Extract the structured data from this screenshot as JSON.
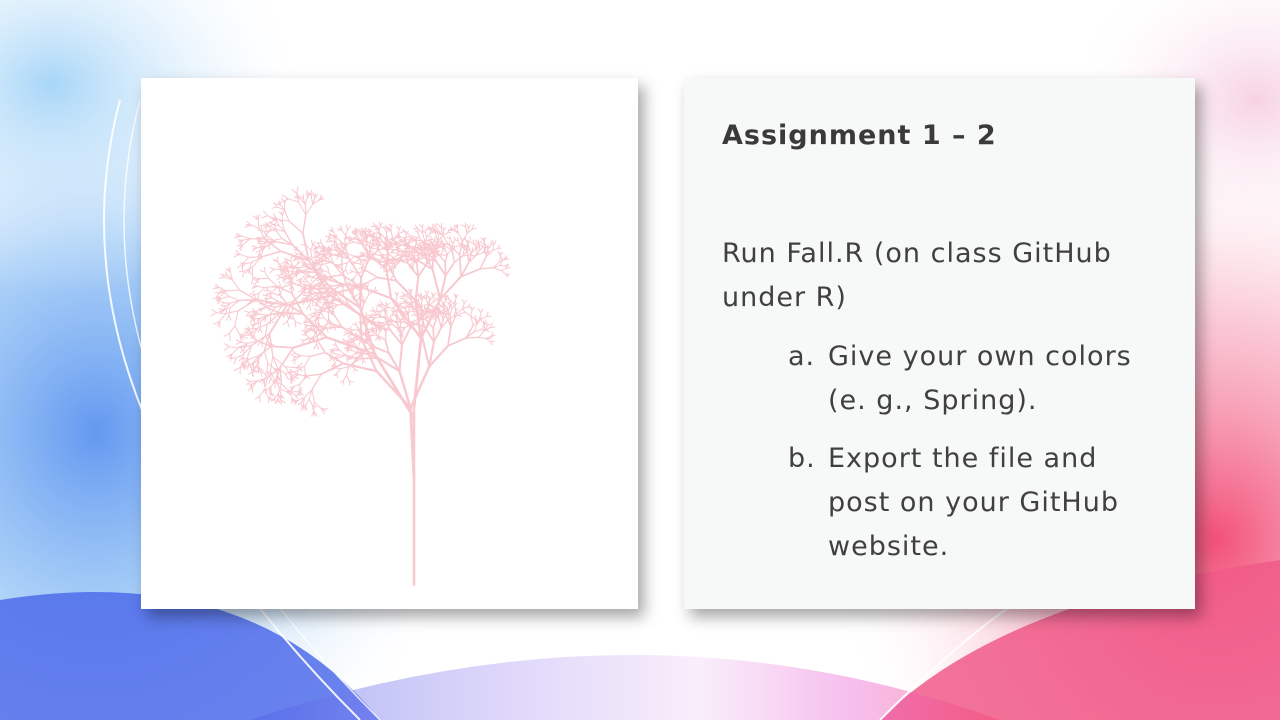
{
  "slide": {
    "title": "Assignment 1 – 2",
    "intro": "Run Fall.R (on class GitHub under R)",
    "items": [
      {
        "marker": "a.",
        "text": "Give your own colors (e. g., Spring)."
      },
      {
        "marker": "b.",
        "text": "Export the file and post on your GitHub website."
      }
    ]
  },
  "image": {
    "subject": "fractal-tree",
    "color": "#f8c9cf"
  },
  "colors": {
    "card_background": "#f7f8f8",
    "text": "#404040",
    "watercolor_blue": "#4a7ee0",
    "watercolor_pink": "#f0507a",
    "watercolor_purple": "#7a4ee8"
  }
}
